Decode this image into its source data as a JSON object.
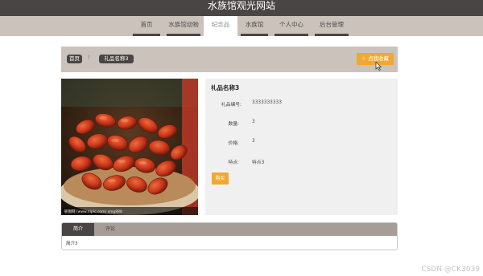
{
  "header": {
    "site_title": "水族馆观光网站"
  },
  "nav": {
    "items": [
      {
        "label": "首页"
      },
      {
        "label": "水族馆动物"
      },
      {
        "label": "纪念品"
      },
      {
        "label": "水族馆"
      },
      {
        "label": "个人中心"
      },
      {
        "label": "后台管理"
      }
    ],
    "active_index": 2
  },
  "breadcrumb": {
    "home": "首页",
    "current": "礼品名称3",
    "separator": "/"
  },
  "favorite_button": {
    "icon": "star-icon",
    "label": "点我收藏"
  },
  "product": {
    "image_caption": "昵图网 (www.nipic.com)   smg888",
    "title": "礼品名称3",
    "fields": [
      {
        "label": "礼品编号:",
        "value": "3333333333"
      },
      {
        "label": "数量:",
        "value": "3"
      },
      {
        "label": "价格:",
        "value": "3"
      },
      {
        "label": "特点:",
        "value": "特点3"
      }
    ],
    "buy_label": "购买"
  },
  "tabs": {
    "items": [
      {
        "label": "简介"
      },
      {
        "label": "评论"
      }
    ],
    "active_index": 0,
    "content": "简介3"
  },
  "watermark": "CSDN @CK3039",
  "colors": {
    "dark": "#4a4545",
    "beige": "#cbc3bb",
    "accent": "#f0a832"
  }
}
